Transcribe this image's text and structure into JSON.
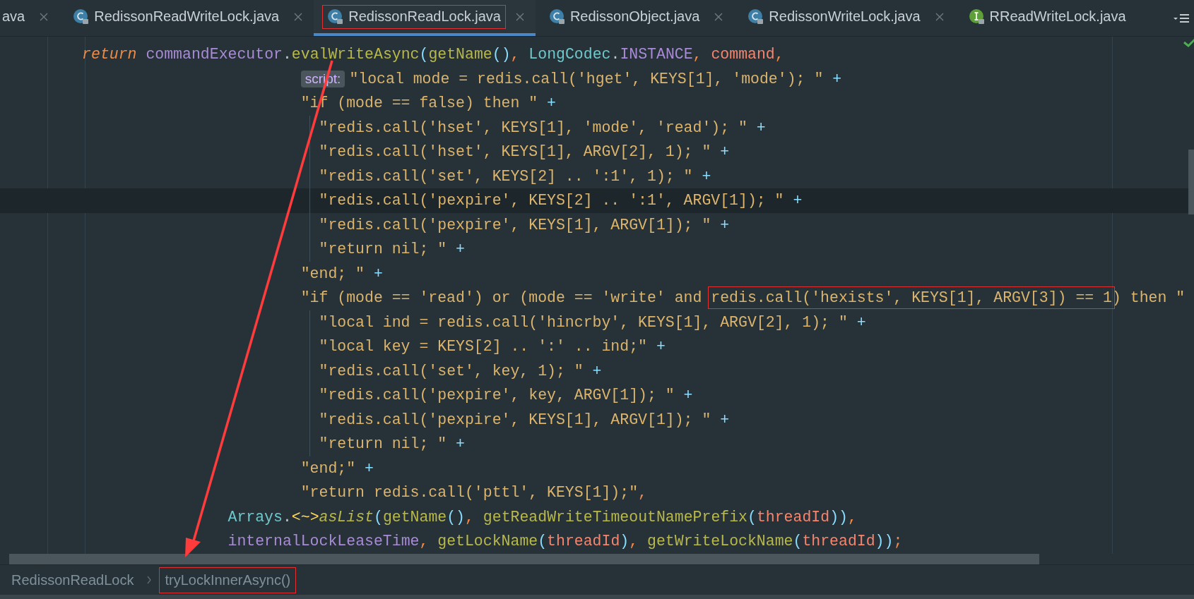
{
  "tabs": [
    {
      "label": "ava",
      "kind": "plain",
      "selected": false,
      "closable": true,
      "annotated": false
    },
    {
      "label": "RedissonReadWriteLock.java",
      "kind": "class",
      "selected": false,
      "closable": true,
      "annotated": false
    },
    {
      "label": "RedissonReadLock.java",
      "kind": "class",
      "selected": true,
      "closable": true,
      "annotated": true
    },
    {
      "label": "RedissonObject.java",
      "kind": "class",
      "selected": false,
      "closable": true,
      "annotated": false
    },
    {
      "label": "RedissonWriteLock.java",
      "kind": "class",
      "selected": false,
      "closable": true,
      "annotated": false
    },
    {
      "label": "RReadWriteLock.java",
      "kind": "interface",
      "selected": false,
      "closable": false,
      "annotated": false
    }
  ],
  "editor": {
    "lines": [
      {
        "kind": "statement",
        "current": false,
        "tokens": [
          {
            "kind": "keyword",
            "text": "return"
          },
          {
            "kind": "field",
            "text": " commandExecutor"
          },
          {
            "kind": "plain",
            "text": "."
          },
          {
            "kind": "method",
            "text": "evalWriteAsync"
          },
          {
            "kind": "paren",
            "text": "("
          },
          {
            "kind": "method",
            "text": "getName"
          },
          {
            "kind": "paren",
            "text": "()"
          },
          {
            "kind": "punct",
            "text": ", "
          },
          {
            "kind": "type",
            "text": "LongCodec"
          },
          {
            "kind": "plain",
            "text": "."
          },
          {
            "kind": "field",
            "text": "INSTANCE"
          },
          {
            "kind": "punct",
            "text": ", "
          },
          {
            "kind": "param",
            "text": "command"
          },
          {
            "kind": "punct",
            "text": ","
          }
        ]
      },
      {
        "kind": "script",
        "current": false,
        "hint": "script:",
        "tokens": [
          {
            "kind": "string",
            "text": "\"local mode = redis.call('hget', KEYS[1], 'mode'); \""
          },
          {
            "kind": "op",
            "text": " +"
          }
        ]
      },
      {
        "kind": "script",
        "current": false,
        "tokens": [
          {
            "kind": "string",
            "text": "\"if (mode == false) then \""
          },
          {
            "kind": "op",
            "text": " +"
          }
        ]
      },
      {
        "kind": "block",
        "current": false,
        "tokens": [
          {
            "kind": "string",
            "text": "\"redis.call('hset', KEYS[1], 'mode', 'read'); \""
          },
          {
            "kind": "op",
            "text": " +"
          }
        ]
      },
      {
        "kind": "block",
        "current": false,
        "tokens": [
          {
            "kind": "string",
            "text": "\"redis.call('hset', KEYS[1], ARGV[2], 1); \""
          },
          {
            "kind": "op",
            "text": " +"
          }
        ]
      },
      {
        "kind": "block",
        "current": false,
        "tokens": [
          {
            "kind": "string",
            "text": "\"redis.call('set', KEYS[2] .. ':1', 1); \""
          },
          {
            "kind": "op",
            "text": " +"
          }
        ]
      },
      {
        "kind": "block",
        "current": true,
        "tokens": [
          {
            "kind": "string",
            "text": "\"redis.call('pexpire', KEYS[2] .. ':1', ARGV[1]); \""
          },
          {
            "kind": "op",
            "text": " +"
          }
        ]
      },
      {
        "kind": "block",
        "current": false,
        "tokens": [
          {
            "kind": "string",
            "text": "\"redis.call('pexpire', KEYS[1], ARGV[1]); \""
          },
          {
            "kind": "op",
            "text": " +"
          }
        ]
      },
      {
        "kind": "block",
        "current": false,
        "tokens": [
          {
            "kind": "string",
            "text": "\"return nil; \""
          },
          {
            "kind": "op",
            "text": " +"
          }
        ]
      },
      {
        "kind": "script",
        "current": false,
        "tokens": [
          {
            "kind": "string",
            "text": "\"end; \""
          },
          {
            "kind": "op",
            "text": " +"
          }
        ]
      },
      {
        "kind": "script",
        "current": false,
        "tokens": [
          {
            "kind": "string",
            "text": "\"if (mode == 'read') or (mode == 'write' and "
          },
          {
            "kind": "marked",
            "text": "redis.call('hexists', KEYS[1], ARGV[3]) == 1"
          },
          {
            "kind": "string",
            "text": ") then \""
          }
        ]
      },
      {
        "kind": "block",
        "current": false,
        "tokens": [
          {
            "kind": "string",
            "text": "\"local ind = redis.call('hincrby', KEYS[1], ARGV[2], 1); \""
          },
          {
            "kind": "op",
            "text": " +"
          }
        ]
      },
      {
        "kind": "block",
        "current": false,
        "tokens": [
          {
            "kind": "string",
            "text": "\"local key = KEYS[2] .. ':' .. ind;\""
          },
          {
            "kind": "op",
            "text": " +"
          }
        ]
      },
      {
        "kind": "block",
        "current": false,
        "tokens": [
          {
            "kind": "string",
            "text": "\"redis.call('set', key, 1); \""
          },
          {
            "kind": "op",
            "text": " +"
          }
        ]
      },
      {
        "kind": "block",
        "current": false,
        "tokens": [
          {
            "kind": "string",
            "text": "\"redis.call('pexpire', key, ARGV[1]); \""
          },
          {
            "kind": "op",
            "text": " +"
          }
        ]
      },
      {
        "kind": "block",
        "current": false,
        "tokens": [
          {
            "kind": "string",
            "text": "\"redis.call('pexpire', KEYS[1], ARGV[1]); \""
          },
          {
            "kind": "op",
            "text": " +"
          }
        ]
      },
      {
        "kind": "block",
        "current": false,
        "tokens": [
          {
            "kind": "string",
            "text": "\"return nil; \""
          },
          {
            "kind": "op",
            "text": " +"
          }
        ]
      },
      {
        "kind": "script",
        "current": false,
        "tokens": [
          {
            "kind": "string",
            "text": "\"end;\""
          },
          {
            "kind": "op",
            "text": " +"
          }
        ]
      },
      {
        "kind": "script",
        "current": false,
        "tokens": [
          {
            "kind": "string",
            "text": "\"return redis.call('pttl', KEYS[1]);\""
          },
          {
            "kind": "punct",
            "text": ","
          }
        ]
      },
      {
        "kind": "argument",
        "current": false,
        "tokens": [
          {
            "kind": "type",
            "text": "Arrays"
          },
          {
            "kind": "plain",
            "text": "."
          },
          {
            "kind": "generic",
            "text": "<~>"
          },
          {
            "kind": "static",
            "text": "asList"
          },
          {
            "kind": "paren",
            "text": "("
          },
          {
            "kind": "method",
            "text": "getName"
          },
          {
            "kind": "paren",
            "text": "()"
          },
          {
            "kind": "punct",
            "text": ", "
          },
          {
            "kind": "method",
            "text": "getReadWriteTimeoutNamePrefix"
          },
          {
            "kind": "paren",
            "text": "("
          },
          {
            "kind": "param",
            "text": "threadId"
          },
          {
            "kind": "paren",
            "text": "))"
          },
          {
            "kind": "punct",
            "text": ","
          }
        ]
      },
      {
        "kind": "argument",
        "current": false,
        "tokens": [
          {
            "kind": "field",
            "text": "internalLockLeaseTime"
          },
          {
            "kind": "punct",
            "text": ", "
          },
          {
            "kind": "method",
            "text": "getLockName"
          },
          {
            "kind": "paren",
            "text": "("
          },
          {
            "kind": "param",
            "text": "threadId"
          },
          {
            "kind": "paren",
            "text": ")"
          },
          {
            "kind": "punct",
            "text": ", "
          },
          {
            "kind": "method",
            "text": "getWriteLockName"
          },
          {
            "kind": "paren",
            "text": "("
          },
          {
            "kind": "param",
            "text": "threadId"
          },
          {
            "kind": "paren",
            "text": "))"
          },
          {
            "kind": "punct",
            "text": ";"
          }
        ]
      }
    ]
  },
  "breadcrumbs": [
    {
      "label": "RedissonReadLock",
      "annotated": false
    },
    {
      "label": "tryLockInnerAsync()",
      "annotated": true
    }
  ]
}
